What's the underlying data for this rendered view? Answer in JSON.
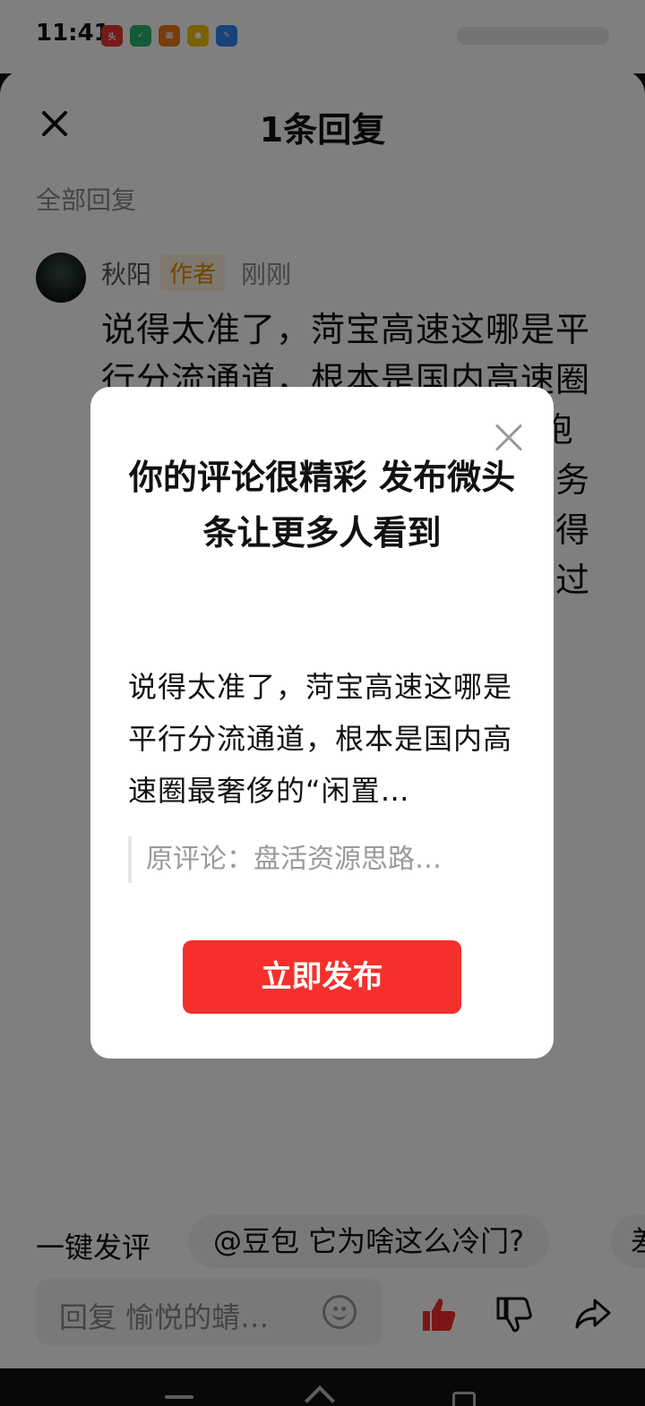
{
  "statusbar": {
    "time": "11:41"
  },
  "sheet": {
    "title": "1条回复",
    "all_replies_label": "全部回复"
  },
  "comment": {
    "author": "秋阳",
    "badge": "作者",
    "time": "刚刚",
    "body": "说得太准了，菏宝高速这哪是平行分流通道，根本是国内高速圈最奢侈的“闲置……它没出观饱千在四级费率比主线还高、服务区连油都加不上、山区限速卡得比谁都死，等于主动把想分流过来"
  },
  "bottom": {
    "quick_label": "一键发评",
    "quick_chip": "@豆包 它为啥这么冷门?",
    "quick_chip2": "差",
    "reply_placeholder": "回复 愉悦的蜻…"
  },
  "modal": {
    "title": "你的评论很精彩 发布微头条让更多人看到",
    "excerpt": "说得太准了，菏宝高速这哪是平行分流通道，根本是国内高速圈最奢侈的“闲置…",
    "quote": "原评论：盘活资源思路…",
    "publish_button": "立即发布"
  },
  "colors": {
    "accent": "#f52f2c",
    "badge_text": "#e68a00"
  }
}
